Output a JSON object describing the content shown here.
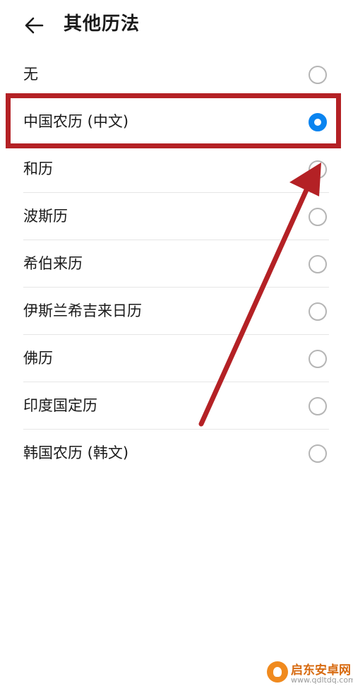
{
  "header": {
    "title": "其他历法",
    "back_icon": "arrow-left-icon"
  },
  "calendar_options": [
    {
      "label": "无",
      "selected": false
    },
    {
      "label": "中国农历 (中文)",
      "selected": true
    },
    {
      "label": "和历",
      "selected": false
    },
    {
      "label": "波斯历",
      "selected": false
    },
    {
      "label": "希伯来历",
      "selected": false
    },
    {
      "label": "伊斯兰希吉来日历",
      "selected": false
    },
    {
      "label": "佛历",
      "selected": false
    },
    {
      "label": "印度国定历",
      "selected": false
    },
    {
      "label": "韩国农历 (韩文)",
      "selected": false
    }
  ],
  "colors": {
    "accent": "#0a84f0",
    "annotation": "#b42125",
    "radio_border": "#b5b5b5"
  },
  "watermark": {
    "name": "启东安卓网",
    "url": "www.qdltdq.com"
  }
}
